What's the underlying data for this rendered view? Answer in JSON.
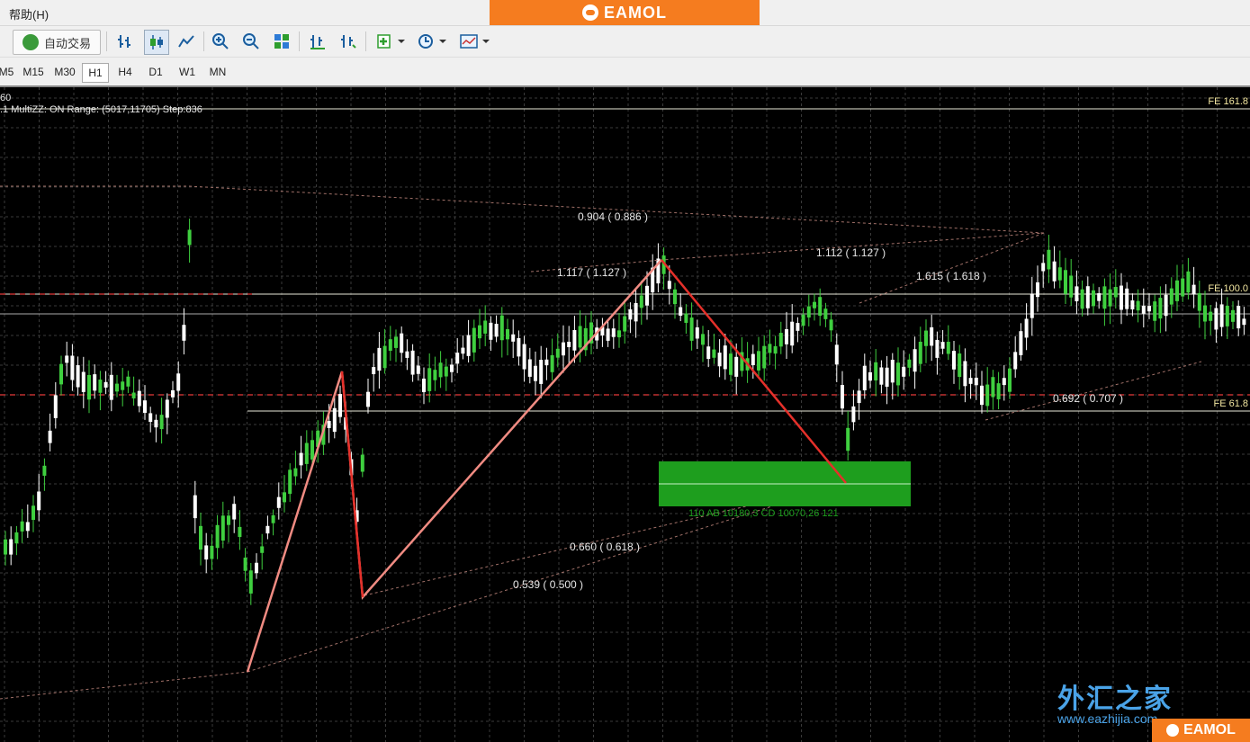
{
  "menubar": {
    "help_label": "帮助(H)"
  },
  "brand": {
    "name": "EAMOL",
    "color": "#f57c1f"
  },
  "toolbar": {
    "auto_trade_label": "自动交易",
    "icons": [
      "bar-chart-icon",
      "candlestick-icon",
      "line-chart-icon",
      "zoom-in-icon",
      "zoom-out-icon",
      "tile-windows-icon",
      "chart-shift-icon",
      "autoscroll-icon",
      "indicators-icon",
      "periods-icon",
      "templates-icon"
    ]
  },
  "timeframes": [
    "M5",
    "M15",
    "M30",
    "H1",
    "H4",
    "D1",
    "W1",
    "MN"
  ],
  "active_timeframe": "H1",
  "chart": {
    "header_line1": "60",
    "header_line2": ".1  MultiZZ: ON  Range: (5017,11705)  Step:836",
    "fe_labels": {
      "fe161": "FE 161.8",
      "fe100": "FE 100.0",
      "fe61": "FE 61.8"
    },
    "ratios": {
      "r0904": "0.904 ( 0.886 )",
      "r1117": "1.117 ( 1.127 )",
      "r1112": "1.112 ( 1.127 )",
      "r1615": "1.615 ( 1.618 )",
      "r0692": "0.692 ( 0.707 )",
      "r0660": "0.660 ( 0.618 )",
      "r0539": "0.539 ( 0.500 )"
    },
    "pattern_label": "110   AB 10180,3 CD 10070,26   121",
    "colors": {
      "bull": "#3fcf3f",
      "bear": "#ffffff",
      "grid": "#3a3a3a",
      "zigzag_main": "#f08b82",
      "zigzag_down": "#e5302a",
      "target_zone": "#1e9e1e"
    }
  },
  "watermark": {
    "zh": "外汇之家",
    "en": "www.eazhijia.com"
  }
}
